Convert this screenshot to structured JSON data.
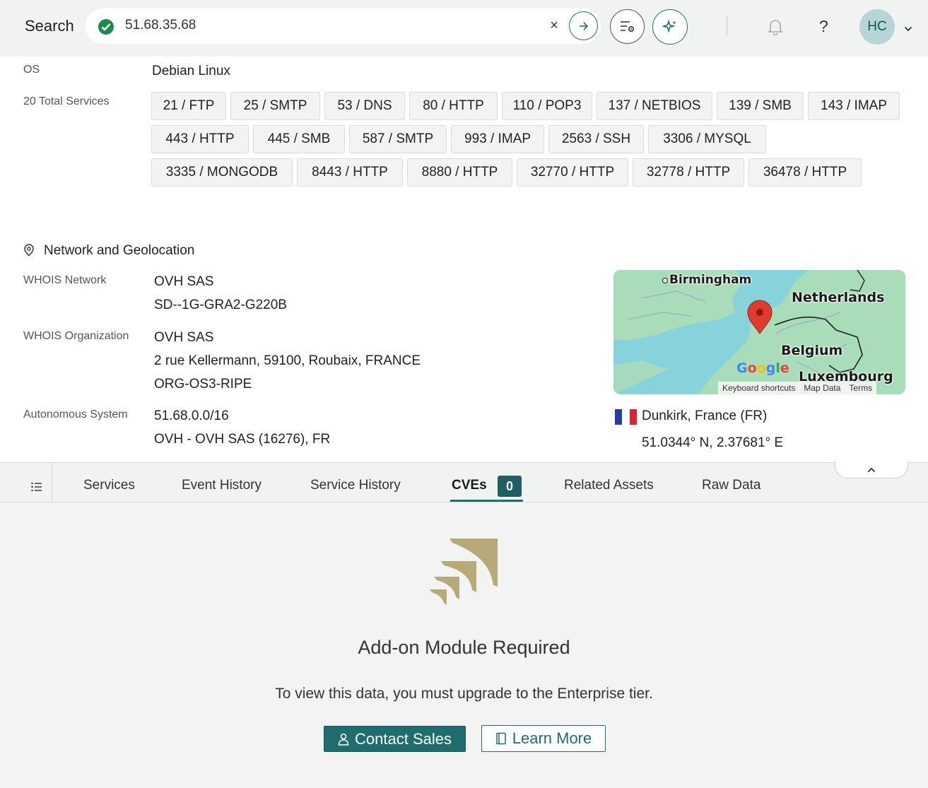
{
  "search": {
    "label": "Search",
    "value": "51.68.35.68",
    "clear": "×"
  },
  "user": {
    "initials": "HC",
    "help": "?"
  },
  "host": {
    "os_label": "OS",
    "os_value": "Debian Linux",
    "services_label": "20 Total Services",
    "services": [
      "21 / FTP",
      "25 / SMTP",
      "53 / DNS",
      "80 / HTTP",
      "110 / POP3",
      "137 / NETBIOS",
      "139 / SMB",
      "143 / IMAP",
      "443 / HTTP",
      "445 / SMB",
      "587 / SMTP",
      "993 / IMAP",
      "2563 / SSH",
      "3306 / MYSQL",
      "3335 / MONGODB",
      "8443 / HTTP",
      "8880 / HTTP",
      "32770 / HTTP",
      "32778 / HTTP",
      "36478 / HTTP"
    ]
  },
  "network": {
    "title": "Network and Geolocation",
    "whois_network_label": "WHOIS Network",
    "whois_network_lines": [
      "OVH SAS",
      "SD--1G-GRA2-G220B"
    ],
    "whois_org_label": "WHOIS Organization",
    "whois_org_lines": [
      "OVH SAS",
      "2 rue Kellermann, 59100, Roubaix, FRANCE",
      "ORG-OS3-RIPE"
    ],
    "as_label": "Autonomous System",
    "as_lines": [
      "51.68.0.0/16",
      "OVH - OVH SAS (16276), FR"
    ]
  },
  "map": {
    "labels": {
      "birmingham": "Birmingham",
      "netherlands": "Netherlands",
      "belgium": "Belgium",
      "luxembourg": "Luxembourg"
    },
    "logo": "Google",
    "footer": [
      "Keyboard shortcuts",
      "Map Data",
      "Terms"
    ],
    "colors": {
      "water": "#86d3dc",
      "land": "#a9dcb8",
      "pin": "#e03b2f"
    }
  },
  "geo": {
    "place": "Dunkirk, France (FR)",
    "coords": "51.0344° N, 2.37681° E",
    "flag_colors": [
      "#1f3ea8",
      "#ffffff",
      "#e0242e"
    ]
  },
  "tabs": {
    "items": [
      "Services",
      "Event History",
      "Service History",
      "CVEs",
      "Related Assets",
      "Raw Data"
    ],
    "active": "CVEs",
    "cve_count": "0"
  },
  "addon": {
    "title": "Add-on Module Required",
    "text": "To view this data, you must upgrade to the Enterprise tier.",
    "contact_label": "Contact Sales",
    "learn_label": "Learn More",
    "accent": "#1f6e6e",
    "logo_color": "#b5aa78"
  }
}
